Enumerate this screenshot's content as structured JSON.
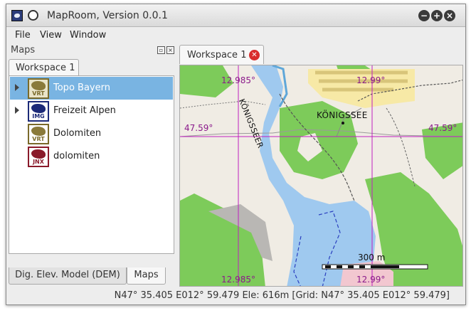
{
  "window": {
    "title": "MapRoom, Version 0.0.1"
  },
  "menu": {
    "items": [
      "File",
      "View",
      "Window"
    ]
  },
  "maps_dock": {
    "title": "Maps",
    "workspace_tab": "Workspace 1",
    "items": [
      {
        "label": "Topo Bayern",
        "tag": "VRT",
        "selected": true,
        "expandable": true
      },
      {
        "label": "Freizeit Alpen",
        "tag": "IMG",
        "selected": false,
        "expandable": true
      },
      {
        "label": "Dolomiten",
        "tag": "VRT",
        "selected": false,
        "expandable": false
      },
      {
        "label": "dolomiten",
        "tag": "JNX",
        "selected": false,
        "expandable": false
      }
    ],
    "bottom_tabs": [
      {
        "label": "Dig. Elev. Model (DEM)",
        "active": false
      },
      {
        "label": "Maps",
        "active": true
      }
    ]
  },
  "map_view": {
    "tab_label": "Workspace 1",
    "grid_labels": {
      "lon_left_top": "12.985°",
      "lon_right_top": "12.99°",
      "lat_left": "47.59°",
      "lat_right": "47.59°",
      "lon_left_bottom": "12.985°",
      "lon_right_bottom": "12.99°"
    },
    "place_label": "KÖNIGSSEE",
    "road_label": "KÖNIGSSEER",
    "scale_label": "300 m"
  },
  "status": {
    "text": "N47° 35.405 E012° 59.479 Ele: 616m [Grid: N47° 35.405 E012° 59.479]"
  },
  "colors": {
    "selection": "#79b4e2",
    "grid_lines": "#c020c0",
    "water": "#9fc9ef",
    "forest": "#7dcb5a",
    "land": "#f0ece4"
  }
}
